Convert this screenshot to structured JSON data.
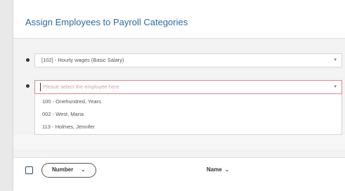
{
  "page": {
    "title": "Assign Employees to Payroll Categories"
  },
  "payroll_category": {
    "value": "[102] - Hourly wages (Basic Salary)",
    "caret": "▾"
  },
  "employee_select": {
    "placeholder": "Please select the employee here",
    "caret": "▾"
  },
  "dropdown": {
    "options": [
      "100 - Onehundred, Years",
      "002 - West, Maria",
      "113 - Holmes, Jennifer"
    ]
  },
  "table": {
    "columns": {
      "number": "Number",
      "name": "Name"
    },
    "sort_chevron": "⌄"
  },
  "icons": {
    "search": "search-icon",
    "dropdown": "caret-down-icon",
    "bullet": "bullet-icon",
    "sort": "chevron-down-icon"
  },
  "colors": {
    "title": "#2d6aa3",
    "active_border": "#d98b8b",
    "placeholder": "#cfa4a4"
  }
}
